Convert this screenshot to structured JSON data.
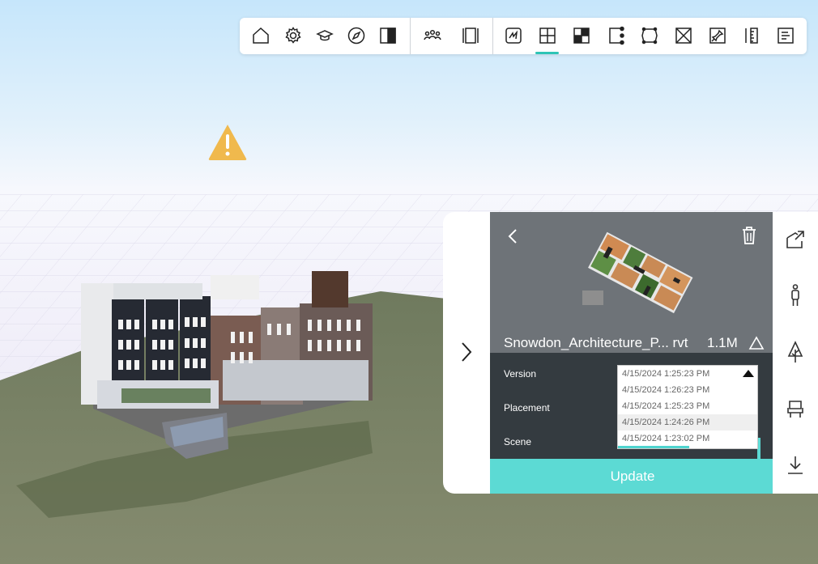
{
  "toolbar": {
    "buttons": [
      {
        "icon": "home-icon"
      },
      {
        "icon": "gear-icon"
      },
      {
        "icon": "graduation-cap-icon"
      },
      {
        "icon": "compass-icon"
      },
      {
        "icon": "split-view-icon"
      },
      {
        "icon": "people-icon"
      },
      {
        "icon": "section-icon"
      },
      {
        "icon": "sketch-icon"
      },
      {
        "icon": "plus-grid-icon",
        "active": true
      },
      {
        "icon": "checker-icon"
      },
      {
        "icon": "edit-point-icon"
      },
      {
        "icon": "select-box-icon"
      },
      {
        "icon": "cross-box-icon"
      },
      {
        "icon": "pin-icon"
      },
      {
        "icon": "measure-icon"
      },
      {
        "icon": "notes-icon"
      }
    ],
    "accent_color": "#2ec4b6"
  },
  "warning": {
    "icon": "warning-icon",
    "color": "#f0b94d"
  },
  "panel": {
    "file_name": "Snowdon_Architecture_P... rvt",
    "file_size": "1.1M",
    "version_label": "Version",
    "placement_label": "Placement",
    "scene_label": "Scene",
    "update_label": "Update",
    "version_options": [
      "4/15/2024 1:25:23 PM",
      "4/15/2024 1:26:23 PM",
      "4/15/2024 1:25:23 PM",
      "4/15/2024 1:24:26 PM",
      "4/15/2024 1:23:02 PM"
    ],
    "accent_color": "#5cdad4",
    "header_color": "#6e7378",
    "body_color": "#343b40"
  },
  "side_tools": [
    {
      "icon": "shape-add-icon"
    },
    {
      "icon": "person-icon"
    },
    {
      "icon": "tree-icon"
    },
    {
      "icon": "chair-icon"
    },
    {
      "icon": "download-icon"
    }
  ]
}
